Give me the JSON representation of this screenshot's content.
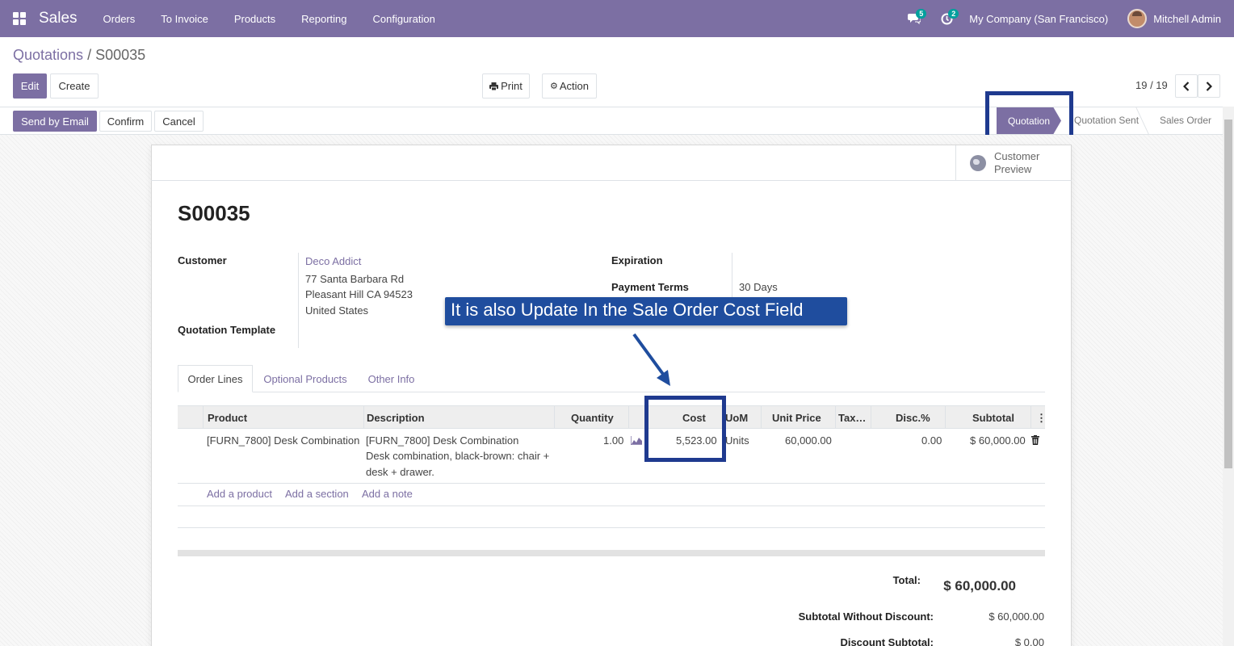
{
  "nav": {
    "app_name": "Sales",
    "menu": [
      "Orders",
      "To Invoice",
      "Products",
      "Reporting",
      "Configuration"
    ],
    "messages_badge": "5",
    "activities_badge": "2",
    "company": "My Company (San Francisco)",
    "user": "Mitchell Admin"
  },
  "breadcrumb": {
    "parent": "Quotations",
    "sep": "/",
    "current": "S00035"
  },
  "buttons": {
    "edit": "Edit",
    "create": "Create",
    "print": "Print",
    "action": "Action",
    "send_email": "Send by Email",
    "confirm": "Confirm",
    "cancel": "Cancel"
  },
  "pager": "19 / 19",
  "stages": {
    "active": "Quotation",
    "sent": "Quotation Sent",
    "order": "Sales Order"
  },
  "preview": {
    "line1": "Customer",
    "line2": "Preview"
  },
  "doc": {
    "title": "S00035",
    "customer_label": "Customer",
    "customer_name": "Deco Addict",
    "address1": "77 Santa Barbara Rd",
    "address2": "Pleasant Hill CA 94523",
    "address3": "United States",
    "template_label": "Quotation Template",
    "expiration_label": "Expiration",
    "terms_label": "Payment Terms",
    "terms_value": "30 Days"
  },
  "annotation": "It is also Update In the Sale Order Cost Field",
  "tabs": [
    "Order Lines",
    "Optional Products",
    "Other Info"
  ],
  "table": {
    "headers": {
      "product": "Product",
      "description": "Description",
      "quantity": "Quantity",
      "cost": "Cost",
      "uom": "UoM",
      "unit_price": "Unit Price",
      "taxes": "Tax…",
      "disc": "Disc.%",
      "subtotal": "Subtotal"
    },
    "row": {
      "product": "[FURN_7800] Desk Combination",
      "desc1": "[FURN_7800] Desk Combination",
      "desc2": "Desk combination, black-brown: chair +",
      "desc3": "desk + drawer.",
      "quantity": "1.00",
      "cost": "5,523.00",
      "uom": "Units",
      "unit_price": "60,000.00",
      "disc": "0.00",
      "subtotal": "$ 60,000.00"
    },
    "add_product": "Add a product",
    "add_section": "Add a section",
    "add_note": "Add a note"
  },
  "totals": {
    "total_label": "Total:",
    "total_value": "$ 60,000.00",
    "no_disc_label": "Subtotal Without Discount:",
    "no_disc_value": "$ 60,000.00",
    "disc_label": "Discount Subtotal:",
    "disc_value": "$ 0.00"
  },
  "colors": {
    "brand": "#7c6fa3",
    "annotation": "#1f4d9e",
    "highlight": "#1f3a8f"
  }
}
